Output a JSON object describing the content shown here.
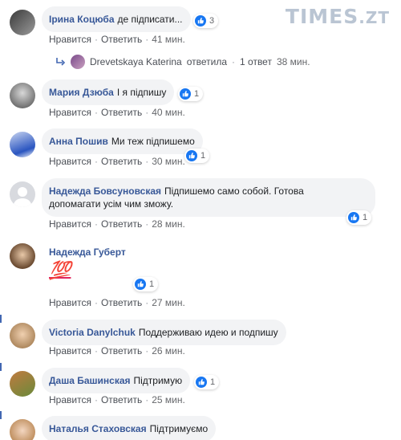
{
  "watermark": {
    "brand": "TIMES",
    "suffix": ".ZT"
  },
  "actions": {
    "like": "Нравится",
    "reply": "Ответить",
    "separator": "·"
  },
  "comments": [
    {
      "name": "Ірина Коцюба",
      "text": "де підписати...",
      "likes": "3",
      "time": "41 мин."
    },
    {
      "name": "Мария Дзюба",
      "text": "І я підпишу",
      "likes": "1",
      "time": "40 мин."
    },
    {
      "name": "Анна Пошив",
      "text": "Ми теж підпишемо",
      "likes": "1",
      "time": "30 мин."
    },
    {
      "name": "Надежда Бовсуновская",
      "text": "Підпишемо само собой. Готова",
      "text2": "допомагати усім чим зможу.",
      "likes": "1",
      "time": "28 мин."
    },
    {
      "name": "Надежда Губерт",
      "text": "💯",
      "likes": "1",
      "time": "27 мин."
    },
    {
      "name": "Victoria Danylchuk",
      "text": "Поддерживаю идею и подпишу",
      "likes": "",
      "time": "26 мин."
    },
    {
      "name": "Даша Башинская",
      "text": "Підтримую",
      "likes": "1",
      "time": "25 мин."
    },
    {
      "name": "Наталья Стаховская",
      "text": "Підтримуємо",
      "likes": "",
      "time": ""
    }
  ],
  "reply_summary": {
    "name": "Drevetskaya Katerina",
    "verb": "ответила",
    "count": "1 ответ",
    "time": "38 мин."
  },
  "colors": {
    "name_link": "#385898",
    "like_blue": "#1877f2",
    "bubble": "#f2f3f5",
    "marker": "#4267b2"
  }
}
